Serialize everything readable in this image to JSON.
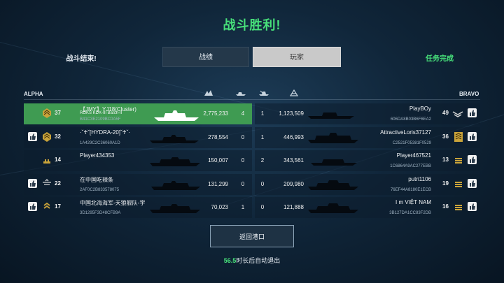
{
  "title": "战斗胜利!",
  "battle_ended": "战斗结束!",
  "tabs": {
    "stats": "战绩",
    "players": "玩家"
  },
  "mission_complete": "任务完成",
  "teams": {
    "alpha": "ALPHA",
    "bravo": "BRAVO"
  },
  "columns_icons": [
    "damage-icon",
    "kills-icon",
    "assists-icon",
    "experience-icon"
  ],
  "alpha": [
    {
      "level": "37",
      "name": "【JMY】YJ18(Cluster)",
      "ship": "ROKS KDX-III Batch-II",
      "id": "B41C3E2109BC0A5F",
      "damage": "2,775,233",
      "kills": "4",
      "assists": "1",
      "score": "1,123,509",
      "highlight": true
    },
    {
      "level": "32",
      "name": "·ˇ♰ˇ[HYDRA-20]ˇ♰ˇ·",
      "id": "1A429C2C36060A1D",
      "damage": "278,554",
      "kills": "0",
      "assists": "1",
      "score": "446,993"
    },
    {
      "level": "14",
      "name": "Player434353",
      "id": "",
      "damage": "150,007",
      "kills": "0",
      "assists": "2",
      "score": "343,561"
    },
    {
      "level": "22",
      "name": "在中国吃辣条",
      "id": "2AF0C2B833578075",
      "damage": "131,299",
      "kills": "0",
      "assists": "0",
      "score": "209,980"
    },
    {
      "level": "17",
      "name": "中国北海海军-天狼舰队-宇",
      "id": "3D1295F3D48CFB9A",
      "damage": "70,023",
      "kills": "1",
      "assists": "0",
      "score": "121,888"
    }
  ],
  "bravo": [
    {
      "level": "49",
      "name": "PlayBOy",
      "id": "606DA8B03B6F6EA2"
    },
    {
      "level": "36",
      "name": "AttractiveLoris37127",
      "id": "C2521F05381F0529"
    },
    {
      "level": "13",
      "name": "Player467521",
      "id": "1C6864A9AC277EBB"
    },
    {
      "level": "19",
      "name": "putri1106",
      "id": "76EF44A8180E1ECB"
    },
    {
      "level": "16",
      "name": "I m VIỆT NAM",
      "id": "3B127DA1CC83F2DB"
    }
  ],
  "return_button": "返回港口",
  "countdown": {
    "seconds": "56.5",
    "text": "时长后自动退出"
  },
  "colors": {
    "accent_green": "#47e07a",
    "highlight_row": "#3f9b52"
  }
}
